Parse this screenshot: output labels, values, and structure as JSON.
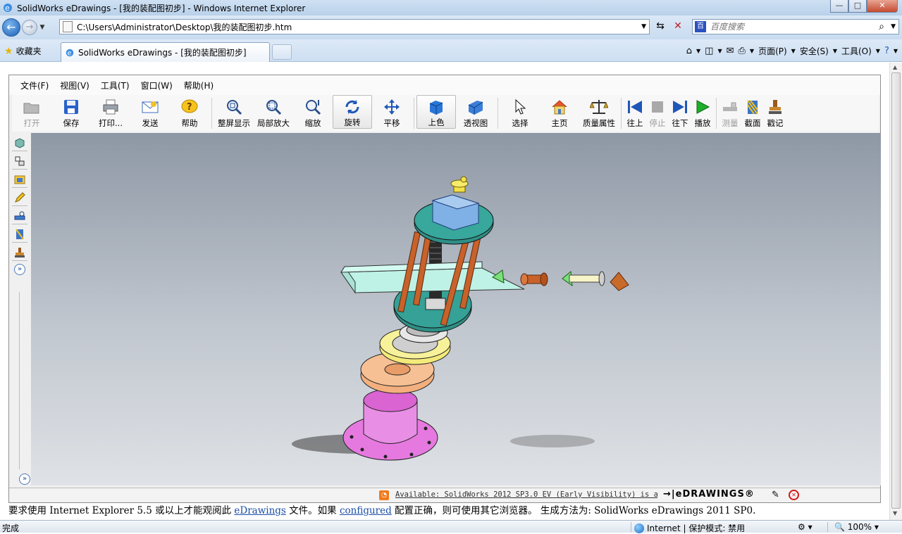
{
  "window": {
    "title": "SolidWorks eDrawings - [我的装配图初步] - Windows Internet Explorer",
    "controls": {
      "minimize": "—",
      "maximize": "□",
      "close": "✕"
    }
  },
  "address_bar": {
    "url": "C:\\Users\\Administrator\\Desktop\\我的装配图初步.htm",
    "search_placeholder": "百度搜索"
  },
  "favorites_label": "收藏夹",
  "tab": {
    "label": "SolidWorks eDrawings - [我的装配图初步]"
  },
  "command_bar": {
    "page": "页面(P)",
    "safety": "安全(S)",
    "tools": "工具(O)"
  },
  "edrawings": {
    "menu": [
      "文件(F)",
      "视图(V)",
      "工具(T)",
      "窗口(W)",
      "帮助(H)"
    ],
    "toolbar": {
      "open": "打开",
      "save": "保存",
      "print": "打印...",
      "send": "发送",
      "help": "帮助",
      "fit": "整屏显示",
      "zoom_area": "局部放大",
      "zoom": "缩放",
      "rotate": "旋转",
      "pan": "平移",
      "shaded": "上色",
      "perspective": "透视图",
      "select": "选择",
      "home": "主页",
      "mass_props": "质量属性",
      "prev": "往上",
      "stop": "停止",
      "next": "往下",
      "play": "播放",
      "measure": "测量",
      "section": "截面",
      "stamp": "戳记"
    },
    "status": {
      "available": "Available: SolidWorks 2012 SP3.0 EV (Early Visibility) is a...",
      "logo": "→|eDRAWINGS®"
    }
  },
  "info_line": {
    "part1": "要求使用  Internet Explorer 5.5 或以上才能观阅此  ",
    "link1": "eDrawings",
    "part2": " 文件。如果  ",
    "link2": "configured",
    "part3": " 配置正确，则可使用其它浏览器。  生成方法为: SolidWorks eDrawings 2011 SP0."
  },
  "statusbar": {
    "left": "完成",
    "zone": "Internet | 保护模式: 禁用",
    "zoom": "100%"
  },
  "colors": {
    "viewport_top": "#8e98a5",
    "viewport_bottom": "#dfe2e6",
    "part_teal": "#2f8f86",
    "part_pink": "#e679e0",
    "part_peach": "#f3b07e",
    "part_yellow": "#f3ea7a",
    "part_blue": "#7fb0e6",
    "part_copper": "#c8622a",
    "beam": "#bff2e6"
  }
}
